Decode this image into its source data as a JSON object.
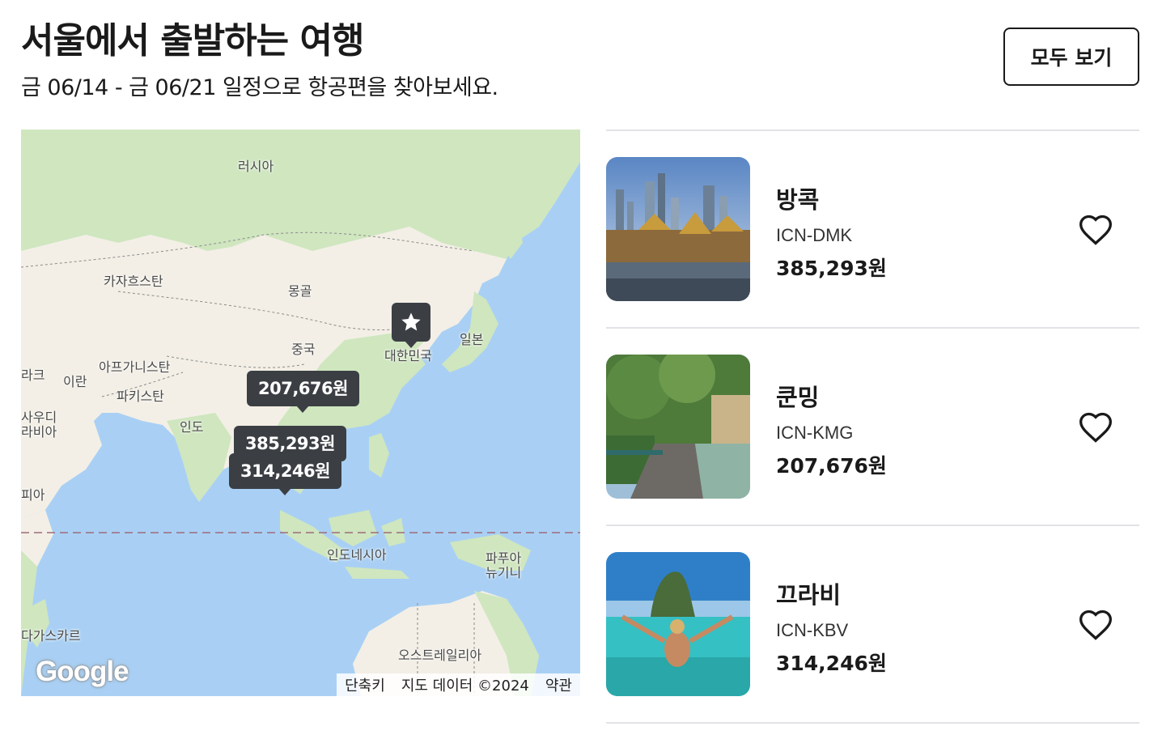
{
  "header": {
    "title": "서울에서 출발하는 여행",
    "subtitle": "금 06/14 - 금 06/21 일정으로 항공편을 찾아보세요.",
    "see_all_label": "모두 보기"
  },
  "map": {
    "labels": {
      "russia": "러시아",
      "kazakhstan": "카자흐스탄",
      "mongolia": "몽골",
      "china": "중국",
      "korea": "대한민국",
      "japan": "일본",
      "afghanistan": "아프가니스탄",
      "iraq": "라크",
      "iran": "이란",
      "pakistan": "파키스탄",
      "india": "인도",
      "saudi_1": "사우디",
      "saudi_2": "라비아",
      "ethiopia": "피아",
      "indonesia": "인도네시아",
      "png_1": "파푸아",
      "png_2": "뉴기니",
      "madagascar": "다가스카르",
      "australia": "오스트레일리아"
    },
    "price_pins": {
      "kunming": "207,676원",
      "bangkok": "385,293원",
      "krabi": "314,246원"
    },
    "origin_icon": "star-icon",
    "logo_text": "Google",
    "attribution": {
      "shortcuts": "단축키",
      "map_data": "지도 데이터 ©2024",
      "terms": "약관"
    }
  },
  "destinations": [
    {
      "city": "방콕",
      "route": "ICN-DMK",
      "price": "385,293원",
      "favorite_icon": "heart-outline-icon"
    },
    {
      "city": "쿤밍",
      "route": "ICN-KMG",
      "price": "207,676원",
      "favorite_icon": "heart-outline-icon"
    },
    {
      "city": "끄라비",
      "route": "ICN-KBV",
      "price": "314,246원",
      "favorite_icon": "heart-outline-icon"
    }
  ],
  "colors": {
    "ocean": "#a9d0f4",
    "land": "#f3efe6",
    "vegetation": "#cfe6bf",
    "pin": "#3b3f44",
    "divider": "#e1e3e6"
  }
}
